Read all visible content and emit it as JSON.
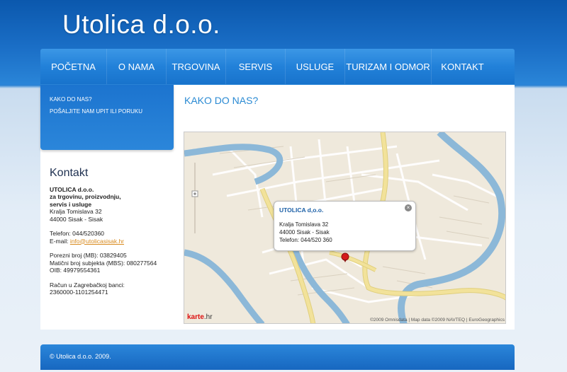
{
  "site": {
    "logo": "Utolica d.o.o."
  },
  "nav": {
    "items": [
      {
        "label": "POČETNA",
        "name": "nav-pocetna"
      },
      {
        "label": "O NAMA",
        "name": "nav-o-nama"
      },
      {
        "label": "TRGOVINA",
        "name": "nav-trgovina"
      },
      {
        "label": "SERVIS",
        "name": "nav-servis"
      },
      {
        "label": "USLUGE",
        "name": "nav-usluge"
      },
      {
        "label": "TURIZAM I ODMOR",
        "name": "nav-turizam"
      },
      {
        "label": "KONTAKT",
        "name": "nav-kontakt"
      }
    ]
  },
  "subnav": {
    "items": [
      {
        "label": "KAKO DO NAS?"
      },
      {
        "label": "POŠALJITE NAM UPIT ILI PORUKU"
      }
    ]
  },
  "contact": {
    "heading": "Kontakt",
    "company": "UTOLICA d.o.o.",
    "desc1": "za trgovinu, proizvodnju,",
    "desc2": "servis i usluge",
    "street": "Kralja Tomislava 32",
    "city": "44000 Sisak - Sisak",
    "phone": "Telefon: 044/520360",
    "email_label": "E-mail: ",
    "email": "info@utolicasisak.hr",
    "tax1": "Porezni broj (MB): 03829405",
    "tax2": "Matični broj subjekta (MBS): 080277564",
    "oib": "OIB: 49979554361",
    "bank_label": "Račun u Zagrebačkoj banci:",
    "bank_number": "2360000-1101254471"
  },
  "main": {
    "title": "KAKO DO NAS?"
  },
  "map": {
    "popup_title": "UTOLICA d,o.o.",
    "popup_street": "Kralja Tomislava 32",
    "popup_city": "44000 Sisak - Sisak",
    "popup_phone": "Telefon: 044/520 360",
    "close_symbol": "×",
    "provider_logo": "karte",
    "provider_suffix": ".hr",
    "credits": "©2009 Omnisdata | Map data ©2009 NAVTEQ | EuroGeographics"
  },
  "footer": {
    "copyright": "© Utolica d.o.o. 2009."
  },
  "colors": {
    "header_blue": "#1a6ec6",
    "link_orange": "#d88a1e",
    "title_blue": "#2a8ad3",
    "river": "#8cb8d8",
    "road_yellow": "#f2e29a",
    "marker_red": "#d41b1b"
  }
}
